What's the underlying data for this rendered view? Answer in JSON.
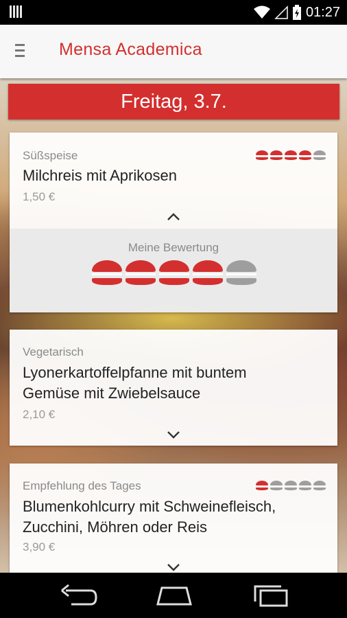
{
  "status_bar": {
    "time": "01:27",
    "icons": [
      "notification-icon",
      "wifi-icon",
      "signal-icon",
      "battery-icon"
    ]
  },
  "app_bar": {
    "title": "Mensa Academica",
    "menu_icon": "hamburger-menu-icon"
  },
  "date_banner": {
    "label": "Freitag, 3.7."
  },
  "meals": [
    {
      "category": "Süßspeise",
      "name_lines": [
        "Milchreis mit Aprikosen"
      ],
      "price": "1,50 €",
      "rating": 4,
      "rating_max": 5,
      "expanded": true
    },
    {
      "category": "Vegetarisch",
      "name_lines": [
        "Lyonerkartoffelpfanne mit buntem",
        "Gemüse mit Zwiebelsauce"
      ],
      "price": "2,10 €",
      "expanded": false
    },
    {
      "category": "Empfehlung des Tages",
      "name_lines": [
        "Blumenkohlcurry mit Schweinefleisch,",
        "Zucchini, Möhren oder Reis"
      ],
      "price": "3,90 €",
      "rating": 1,
      "rating_max": 5,
      "expanded": false
    }
  ],
  "my_rating": {
    "label": "Meine Bewertung",
    "value": 4,
    "max": 5
  },
  "colors": {
    "accent": "#d32f2f",
    "burger_inactive": "#9e9e9e",
    "app_bar_bg": "#f7f7f7"
  },
  "nav_bar": {
    "buttons": [
      "back-icon",
      "home-icon",
      "recent-apps-icon"
    ]
  }
}
